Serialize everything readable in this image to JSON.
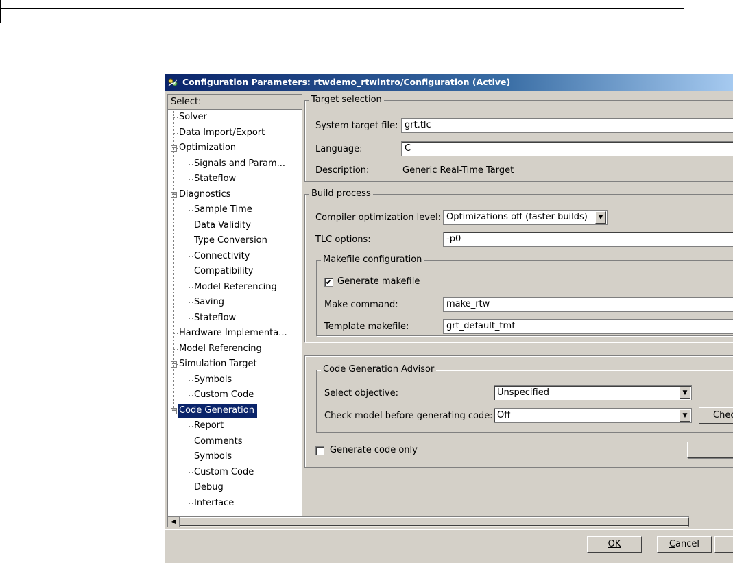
{
  "window": {
    "title": "Configuration Parameters: rtwdemo_rtwintro/Configuration (Active)",
    "app_icon": "simulink-config-icon"
  },
  "tree": {
    "header": "Select:",
    "items": [
      {
        "label": "Solver",
        "level": 0
      },
      {
        "label": "Data Import/Export",
        "level": 0
      },
      {
        "label": "Optimization",
        "level": 0,
        "expanded": true
      },
      {
        "label": "Signals and Param...",
        "level": 1
      },
      {
        "label": "Stateflow",
        "level": 1
      },
      {
        "label": "Diagnostics",
        "level": 0,
        "expanded": true
      },
      {
        "label": "Sample Time",
        "level": 1
      },
      {
        "label": "Data Validity",
        "level": 1
      },
      {
        "label": "Type Conversion",
        "level": 1
      },
      {
        "label": "Connectivity",
        "level": 1
      },
      {
        "label": "Compatibility",
        "level": 1
      },
      {
        "label": "Model Referencing",
        "level": 1
      },
      {
        "label": "Saving",
        "level": 1
      },
      {
        "label": "Stateflow",
        "level": 1
      },
      {
        "label": "Hardware Implementa...",
        "level": 0
      },
      {
        "label": "Model Referencing",
        "level": 0
      },
      {
        "label": "Simulation Target",
        "level": 0,
        "expanded": true
      },
      {
        "label": "Symbols",
        "level": 1
      },
      {
        "label": "Custom Code",
        "level": 1
      },
      {
        "label": "Code Generation",
        "level": 0,
        "expanded": true,
        "selected": true
      },
      {
        "label": "Report",
        "level": 1
      },
      {
        "label": "Comments",
        "level": 1
      },
      {
        "label": "Symbols",
        "level": 1
      },
      {
        "label": "Custom Code",
        "level": 1
      },
      {
        "label": "Debug",
        "level": 1
      },
      {
        "label": "Interface",
        "level": 1
      }
    ]
  },
  "target_selection": {
    "legend": "Target selection",
    "system_target_file_label": "System target file:",
    "system_target_file_value": "grt.tlc",
    "language_label": "Language:",
    "language_value": "C",
    "description_label": "Description:",
    "description_value": "Generic Real-Time Target"
  },
  "build_process": {
    "legend": "Build process",
    "compiler_opt_label": "Compiler optimization level:",
    "compiler_opt_value": "Optimizations off (faster builds)",
    "tlc_options_label": "TLC options:",
    "tlc_options_value": "-p0",
    "makefile": {
      "legend": "Makefile configuration",
      "generate_makefile_label": "Generate makefile",
      "generate_makefile_checked": true,
      "make_command_label": "Make command:",
      "make_command_value": "make_rtw",
      "template_makefile_label": "Template makefile:",
      "template_makefile_value": "grt_default_tmf"
    }
  },
  "advisor": {
    "legend": "Code Generation Advisor",
    "select_objective_label": "Select objective:",
    "select_objective_value": "Unspecified",
    "check_model_label": "Check model before generating code:",
    "check_model_value": "Off",
    "check_button_label": "Chec"
  },
  "generate_code_only": {
    "label": "Generate code only",
    "checked": false
  },
  "buttons": {
    "ok_label": "OK",
    "cancel_label": "Cancel"
  }
}
